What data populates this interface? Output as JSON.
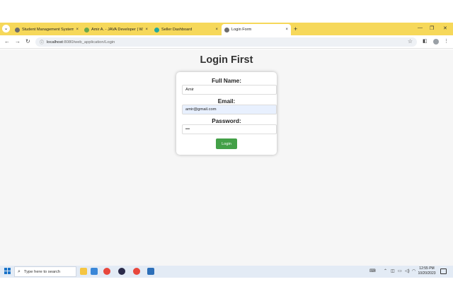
{
  "browser": {
    "tabs": [
      {
        "title": "Student Management System",
        "favicon_color": "#6d6d6d",
        "active": false
      },
      {
        "title": "Amir A. - JAVA Developer | W...",
        "favicon_color": "#6aa84f",
        "active": false
      },
      {
        "title": "Seller Dashboard",
        "favicon_color": "#23a9a0",
        "active": false
      },
      {
        "title": "Login Form",
        "favicon_color": "#6d6d6d",
        "active": true
      }
    ],
    "tab_close_glyph": "×",
    "new_tab_glyph": "+",
    "address": {
      "host": "localhost",
      "path": ":8080/web_application/Login"
    },
    "accent_color": "#f6d85a"
  },
  "page": {
    "title": "Login First",
    "form": {
      "fullname_label": "Full Name:",
      "fullname_value": "Amir",
      "email_label": "Email:",
      "email_value": "amir@gmail.com",
      "password_label": "Password:",
      "password_value": "•••",
      "submit_label": "Login",
      "submit_color": "#43a047"
    }
  },
  "taskbar": {
    "search_placeholder": "Type here to search",
    "time": "12:55 PM",
    "date": "10/20/2023"
  }
}
